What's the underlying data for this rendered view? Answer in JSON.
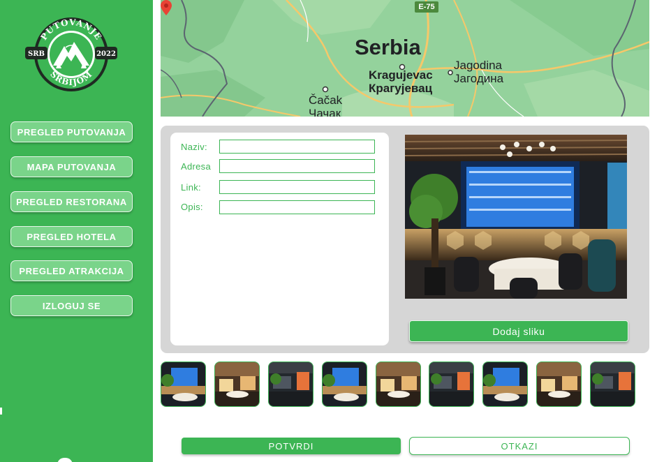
{
  "logo": {
    "top_text": "PUTOVANJE",
    "bottom_text": "SRBIJOM",
    "left_badge": "SRB",
    "right_badge": "2022"
  },
  "sidebar": {
    "items": [
      {
        "label": "PREGLED PUTOVANJA"
      },
      {
        "label": "MAPA PUTOVANJA"
      },
      {
        "label": "PREGLED RESTORANA"
      },
      {
        "label": "PREGLED HOTELA"
      },
      {
        "label": "PREGLED ATRAKCIJA"
      },
      {
        "label": "IZLOGUJ SE"
      }
    ]
  },
  "map": {
    "road": "E-75",
    "country": "Serbia",
    "cities": [
      {
        "latin": "Kragujevac",
        "cyrillic": "Крагујевац"
      },
      {
        "latin": "Jagodina",
        "cyrillic": "Јагодина"
      },
      {
        "latin": "Čačak",
        "cyrillic": "Чачак"
      }
    ]
  },
  "form": {
    "fields": [
      {
        "label": "Naziv:",
        "value": ""
      },
      {
        "label": "Adresa",
        "value": ""
      },
      {
        "label": "Link:",
        "value": ""
      },
      {
        "label": "Opis:",
        "value": ""
      }
    ]
  },
  "actions": {
    "add_photo": "Dodaj sliku",
    "confirm": "POTVRDI",
    "cancel": "OTKAZI"
  },
  "gallery": {
    "thumbnails": [
      "bar",
      "dining",
      "dark",
      "bar",
      "dining",
      "dark",
      "bar",
      "dining",
      "dark"
    ]
  },
  "colors": {
    "brand_green": "#3cb554",
    "sidebar_button": "#7ad48a",
    "panel_gray": "#d6d6d6"
  }
}
